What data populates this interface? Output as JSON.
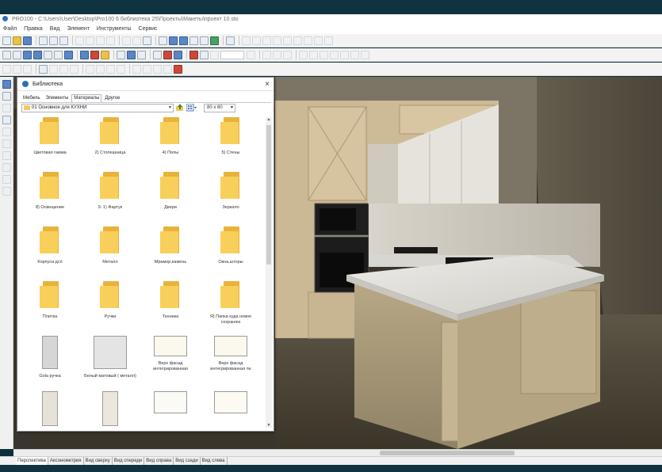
{
  "app": {
    "title": "PRO100 - C:\\Users\\User\\Desktop\\Pro100 6 библиотека 25\\Проекты\\Макеты\\проект 10.sto"
  },
  "menu": [
    "Файл",
    "Правка",
    "Вид",
    "Элемент",
    "Инструменты",
    "Сервис"
  ],
  "library": {
    "title": "Библиотека",
    "tabs": [
      "Мебель",
      "Элементы",
      "Материалы",
      "Другое"
    ],
    "active_tab": "Материалы",
    "path": "01 Основное для КУХНИ",
    "thumb_size": "80 x 80",
    "close_label": "×",
    "items": [
      {
        "label": "Цветовая гамма",
        "kind": "folder"
      },
      {
        "label": "2) Столешница",
        "kind": "folder"
      },
      {
        "label": "4) Полы",
        "kind": "folder"
      },
      {
        "label": "5) Стены",
        "kind": "folder"
      },
      {
        "label": "8) Освещение",
        "kind": "folder"
      },
      {
        "label": "9. 1) Фартук",
        "kind": "folder"
      },
      {
        "label": "Двери",
        "kind": "folder"
      },
      {
        "label": "Зеркало",
        "kind": "folder"
      },
      {
        "label": "Корпуса дсп",
        "kind": "folder"
      },
      {
        "label": "Металл",
        "kind": "folder"
      },
      {
        "label": "Мрамор,камень",
        "kind": "folder"
      },
      {
        "label": "Окна,шторы",
        "kind": "folder"
      },
      {
        "label": "Плитка",
        "kind": "folder"
      },
      {
        "label": "Ручки",
        "kind": "folder"
      },
      {
        "label": "Техника",
        "kind": "folder"
      },
      {
        "label": "Я) Папка куда новое сохраняю",
        "kind": "folder"
      },
      {
        "label": "Gola ручка",
        "kind": "material",
        "color": "#d6d6d6"
      },
      {
        "label": "Белый матовый ( металл)",
        "kind": "material",
        "color": "#e4e4e4"
      },
      {
        "label": "Верх фасад интегрированная",
        "kind": "material",
        "color": "#fbf8ee"
      },
      {
        "label": "Верх фасад интегрированная пн",
        "kind": "material",
        "color": "#fbf8ee"
      },
      {
        "label": "",
        "kind": "material",
        "color": "#e7e2d8"
      },
      {
        "label": "",
        "kind": "material",
        "color": "#ece7dc"
      },
      {
        "label": "",
        "kind": "material",
        "color": "#fbfaf4"
      },
      {
        "label": "",
        "kind": "material",
        "color": "#fcfaf2"
      }
    ]
  },
  "view_tabs": [
    "Перспектива",
    "Аксонометрия",
    "Вид сверху",
    "Вид спереди",
    "Вид справа",
    "Вид сзади",
    "Вид слева"
  ],
  "colors": {
    "accent": "#2b6fb8",
    "folder": "#f8cf5a",
    "cabinet": "#cbb894",
    "countertop": "#e8e6e2"
  }
}
